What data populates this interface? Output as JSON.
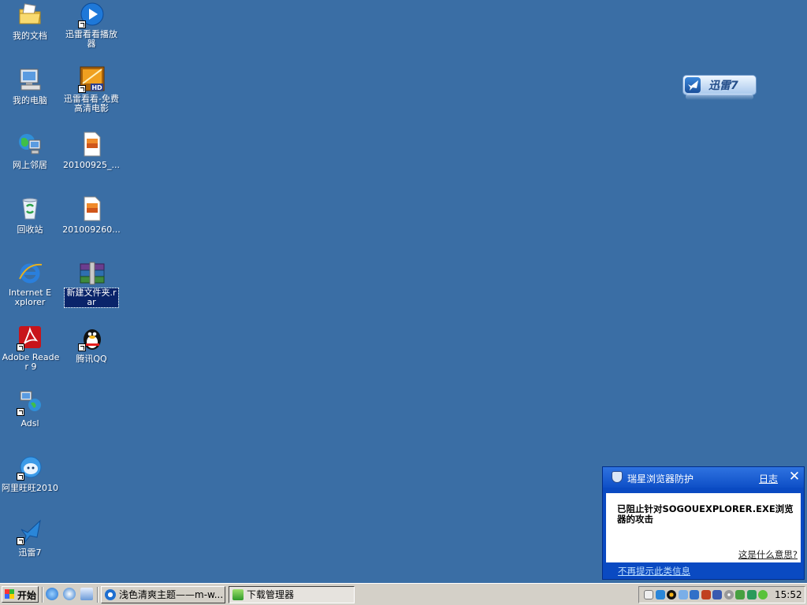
{
  "desktop": {
    "icons": [
      {
        "label": "我的文档"
      },
      {
        "label": "我的电脑"
      },
      {
        "label": "网上邻居"
      },
      {
        "label": "回收站"
      },
      {
        "label": "Internet Explorer"
      },
      {
        "label": "Adobe Reader 9"
      },
      {
        "label": "Adsl"
      },
      {
        "label": "阿里旺旺2010"
      },
      {
        "label": "迅雷7"
      },
      {
        "label": "迅雷看看播放器"
      },
      {
        "label": "迅雷看看-免费高清电影"
      },
      {
        "label": "20100925_..."
      },
      {
        "label": "201009260..."
      },
      {
        "label": "新建文件夹.rar"
      },
      {
        "label": "腾讯QQ"
      }
    ],
    "icon_badge_hd": "HD"
  },
  "xunlei_widget": {
    "label": "迅雷7"
  },
  "popup": {
    "title": "瑞星浏览器防护",
    "log_link": "日志",
    "close_glyph": "✕",
    "message": "已阻止针对SOGOUEXPLORER.EXE浏览器的攻击",
    "what_link": "这是什么意思?",
    "no_remind_link": "不再提示此类信息"
  },
  "taskbar": {
    "start_label": "开始",
    "tasks": [
      {
        "label": "浅色清爽主题——m-w..."
      },
      {
        "label": "下载管理器"
      }
    ],
    "clock": "15:52"
  },
  "colors": {
    "desktop": "#3a6ea5",
    "taskbar": "#d4d0c8",
    "popup_title": "#0e4fc7"
  }
}
